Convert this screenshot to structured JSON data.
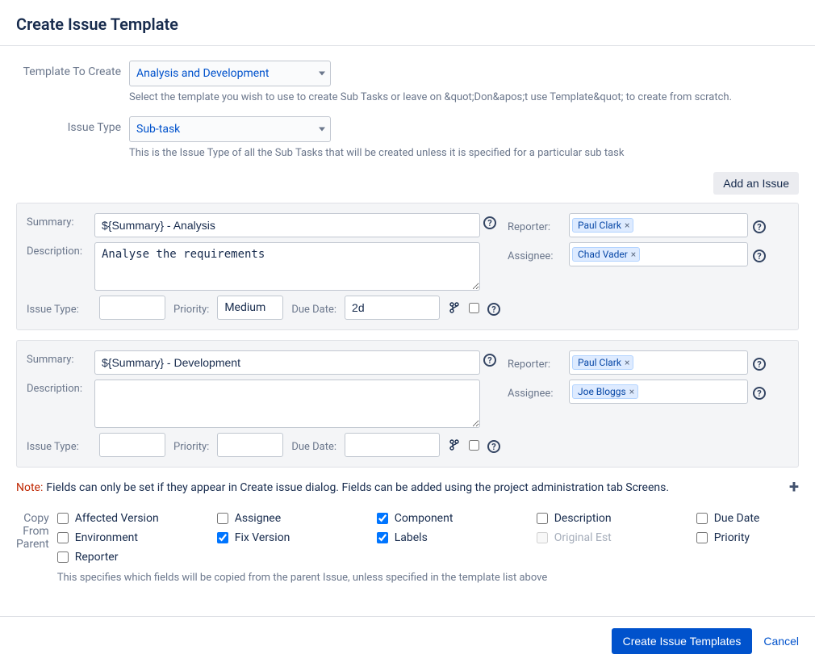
{
  "header": {
    "title": "Create Issue Template"
  },
  "templateField": {
    "label": "Template To Create",
    "value": "Analysis and Development",
    "hint": "Select the template you wish to use to create Sub Tasks or leave on &quot;Don&apos;t use Template&quot; to create from scratch."
  },
  "issueTypeField": {
    "label": "Issue Type",
    "value": "Sub-task",
    "hint": "This is the Issue Type of all the Sub Tasks that will be created unless it is specified for a particular sub task"
  },
  "addIssueLabel": "Add an Issue",
  "issues": [
    {
      "summaryLabel": "Summary:",
      "summary": "${Summary} - Analysis",
      "descriptionLabel": "Description:",
      "description": "Analyse the requirements",
      "reporterLabel": "Reporter:",
      "reporter": "Paul Clark",
      "assigneeLabel": "Assignee:",
      "assignee": "Chad Vader",
      "issueTypeLabel": "Issue Type:",
      "issueType": "",
      "priorityLabel": "Priority:",
      "priority": "Medium",
      "dueDateLabel": "Due Date:",
      "dueDate": "2d"
    },
    {
      "summaryLabel": "Summary:",
      "summary": "${Summary} - Development",
      "descriptionLabel": "Description:",
      "description": "",
      "reporterLabel": "Reporter:",
      "reporter": "Paul Clark",
      "assigneeLabel": "Assignee:",
      "assignee": "Joe Bloggs",
      "issueTypeLabel": "Issue Type:",
      "issueType": "",
      "priorityLabel": "Priority:",
      "priority": "",
      "dueDateLabel": "Due Date:",
      "dueDate": ""
    }
  ],
  "note": {
    "prefix": "Note:",
    "text": "Fields can only be set if they appear in Create issue dialog. Fields can be added using the project administration tab Screens."
  },
  "copySection": {
    "label": "Copy From Parent",
    "hint": "This specifies which fields will be copied from the parent Issue, unless specified in the template list above",
    "items": [
      {
        "label": "Affected Version",
        "checked": false,
        "disabled": false
      },
      {
        "label": "Assignee",
        "checked": false,
        "disabled": false
      },
      {
        "label": "Component",
        "checked": true,
        "disabled": false
      },
      {
        "label": "Description",
        "checked": false,
        "disabled": false
      },
      {
        "label": "Due Date",
        "checked": false,
        "disabled": false
      },
      {
        "label": "Environment",
        "checked": false,
        "disabled": false
      },
      {
        "label": "Fix Version",
        "checked": true,
        "disabled": false
      },
      {
        "label": "Labels",
        "checked": true,
        "disabled": false
      },
      {
        "label": "Original Est",
        "checked": false,
        "disabled": true
      },
      {
        "label": "Priority",
        "checked": false,
        "disabled": false
      },
      {
        "label": "Reporter",
        "checked": false,
        "disabled": false
      }
    ]
  },
  "footer": {
    "primary": "Create Issue Templates",
    "cancel": "Cancel"
  }
}
